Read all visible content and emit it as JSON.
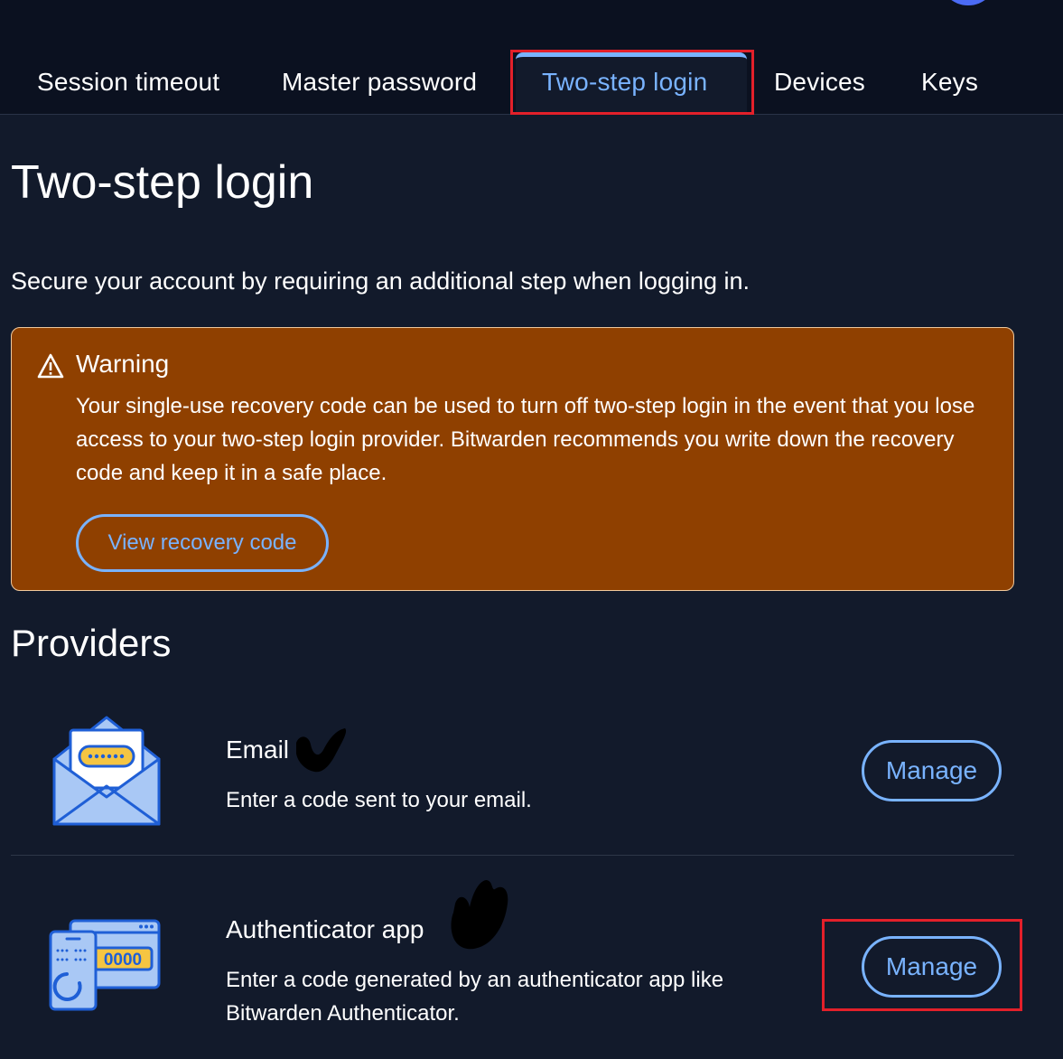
{
  "tabs": [
    {
      "label": "Session timeout"
    },
    {
      "label": "Master password"
    },
    {
      "label": "Two-step login",
      "active": true
    },
    {
      "label": "Devices"
    },
    {
      "label": "Keys"
    }
  ],
  "page": {
    "title": "Two-step login",
    "intro": "Secure your account by requiring an additional step when logging in."
  },
  "warning": {
    "title": "Warning",
    "body": "Your single-use recovery code can be used to turn off two-step login in the event that you lose access to your two-step login provider. Bitwarden recommends you write down the recovery code and keep it in a safe place.",
    "button_label": "View recovery code",
    "icon": "warning-triangle-icon"
  },
  "providers": {
    "heading": "Providers",
    "items": [
      {
        "name": "Email",
        "description": "Enter a code sent to your email.",
        "button_label": "Manage",
        "icon": "email-envelope-icon"
      },
      {
        "name": "Authenticator app",
        "description": "Enter a code generated by an authenticator app like Bitwarden Authenticator.",
        "button_label": "Manage",
        "icon": "authenticator-app-icon",
        "icon_text": "0000"
      }
    ]
  },
  "colors": {
    "background": "#121a2b",
    "topbar": "#0b1120",
    "accent": "#79b3ff",
    "warning_bg": "#8f4000",
    "highlight": "#e3202a"
  }
}
